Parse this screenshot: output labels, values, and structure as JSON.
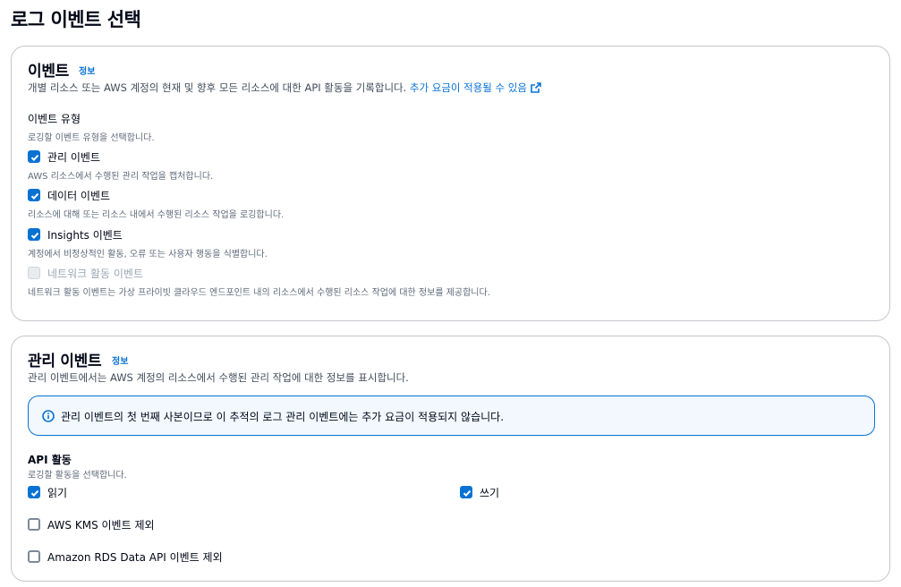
{
  "page": {
    "title": "로그 이벤트 선택"
  },
  "events_panel": {
    "title": "이벤트",
    "info_label": "정보",
    "description": "개별 리소스 또는 AWS 계정의 현재 및 향후 모든 리소스에 대한 API 활동을 기록합니다.",
    "extra_charge_link": "추가 요금이 적용될 수 있음",
    "event_type_label": "이벤트 유형",
    "event_type_hint": "로깅할 이벤트 유형을 선택합니다.",
    "options": [
      {
        "label": "관리 이벤트",
        "description": "AWS 리소스에서 수행된 관리 작업을 캡처합니다.",
        "checked": true,
        "disabled": false
      },
      {
        "label": "데이터 이벤트",
        "description": "리소스에 대해 또는 리소스 내에서 수행된 리소스 작업을 로깅합니다.",
        "checked": true,
        "disabled": false
      },
      {
        "label": "Insights 이벤트",
        "description": "계정에서 비정상적인 활동, 오류 또는 사용자 행동을 식별합니다.",
        "checked": true,
        "disabled": false
      },
      {
        "label": "네트워크 활동 이벤트",
        "description": "네트워크 활동 이벤트는 가상 프라이빗 클라우드 엔드포인트 내의 리소스에서 수행된 리소스 작업에 대한 정보를 제공합니다.",
        "checked": false,
        "disabled": true
      }
    ]
  },
  "management_panel": {
    "title": "관리 이벤트",
    "info_label": "정보",
    "description": "관리 이벤트에서는 AWS 계정의 리소스에서 수행된 관리 작업에 대한 정보를 표시합니다.",
    "alert_text": "관리 이벤트의 첫 번째 사본이므로 이 추적의 로그 관리 이벤트에는 추가 요금이 적용되지 않습니다.",
    "api_activity_label": "API 활동",
    "api_activity_hint": "로깅할 활동을 선택합니다.",
    "read_label": "읽기",
    "read_checked": true,
    "write_label": "쓰기",
    "write_checked": true,
    "exclude_kms_label": "AWS KMS 이벤트 제외",
    "exclude_kms_checked": false,
    "exclude_rds_label": "Amazon RDS Data API 이벤트 제외",
    "exclude_rds_checked": false
  },
  "colors": {
    "accent": "#0972d3",
    "border": "#c6c6cd",
    "alert_bg": "#f2f8fd"
  }
}
